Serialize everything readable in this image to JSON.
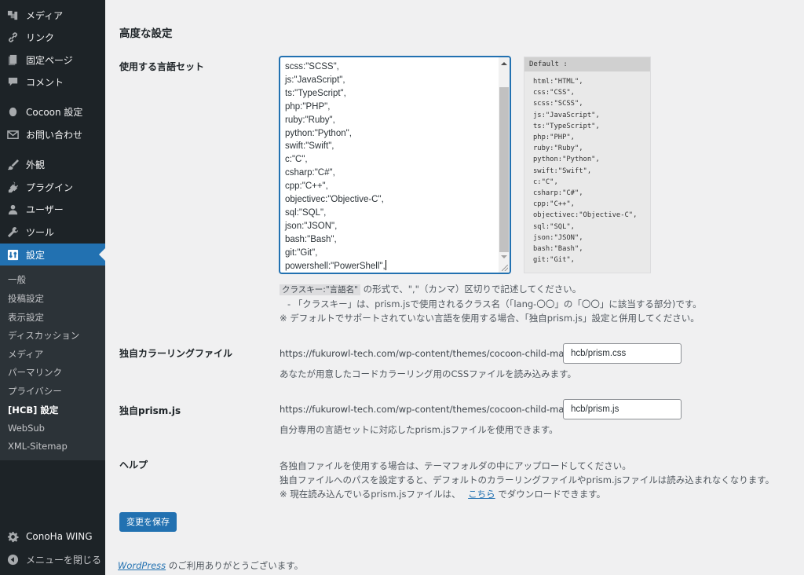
{
  "sidebar": {
    "menu": [
      {
        "label": "メディア",
        "icon": "media-icon"
      },
      {
        "label": "リンク",
        "icon": "link-icon"
      },
      {
        "label": "固定ページ",
        "icon": "page-icon"
      },
      {
        "label": "コメント",
        "icon": "comment-icon"
      },
      {
        "label": "Cocoon 設定",
        "icon": "cocoon-icon"
      },
      {
        "label": "お問い合わせ",
        "icon": "mail-icon"
      },
      {
        "label": "外観",
        "icon": "appearance-icon"
      },
      {
        "label": "プラグイン",
        "icon": "plugin-icon"
      },
      {
        "label": "ユーザー",
        "icon": "user-icon"
      },
      {
        "label": "ツール",
        "icon": "tool-icon"
      },
      {
        "label": "設定",
        "icon": "settings-icon"
      }
    ],
    "submenu": [
      "一般",
      "投稿設定",
      "表示設定",
      "ディスカッション",
      "メディア",
      "パーマリンク",
      "プライバシー",
      "[HCB] 設定",
      "WebSub",
      "XML-Sitemap"
    ],
    "submenu_active": "[HCB] 設定",
    "conoha": "ConoHa WING",
    "collapse": "メニューを閉じる"
  },
  "main": {
    "section_title": "高度な設定",
    "lang_set": {
      "label": "使用する言語セット",
      "textarea_lines": [
        "scss:\"SCSS\",",
        "js:\"JavaScript\",",
        "ts:\"TypeScript\",",
        "php:\"PHP\",",
        "ruby:\"Ruby\",",
        "python:\"Python\",",
        "swift:\"Swift\",",
        "c:\"C\",",
        "csharp:\"C#\",",
        "cpp:\"C++\",",
        "objectivec:\"Objective-C\",",
        "sql:\"SQL\",",
        "json:\"JSON\",",
        "bash:\"Bash\",",
        "git:\"Git\",",
        "powershell:\"PowerShell\","
      ],
      "default_header": "Default :",
      "default_lines": [
        "html:\"HTML\",",
        "css:\"CSS\",",
        "scss:\"SCSS\",",
        "js:\"JavaScript\",",
        "ts:\"TypeScript\",",
        "php:\"PHP\",",
        "ruby:\"Ruby\",",
        "python:\"Python\",",
        "swift:\"Swift\",",
        "c:\"C\",",
        "csharp:\"C#\",",
        "cpp:\"C++\",",
        "objectivec:\"Objective-C\",",
        "sql:\"SQL\",",
        "json:\"JSON\",",
        "bash:\"Bash\",",
        "git:\"Git\","
      ],
      "note_chip": "クラスキー:\"言語名\"",
      "note1": " の形式で、\",\"（カンマ）区切りで記述してください。",
      "note2": "- 「クラスキー」は、prism.jsで使用されるクラス名（「lang-〇〇」の「〇〇」に該当する部分)です。",
      "note3": "※ デフォルトでサポートされていない言語を使用する場合、「独自prism.js」設定と併用してください。"
    },
    "coloring": {
      "label": "独自カラーリングファイル",
      "prefix": "https://fukurowl-tech.com/wp-content/themes/cocoon-child-master/",
      "value": "hcb/prism.css",
      "desc": "あなたが用意したコードカラーリング用のCSSファイルを読み込みます。"
    },
    "prism": {
      "label": "独自prism.js",
      "prefix": "https://fukurowl-tech.com/wp-content/themes/cocoon-child-master/",
      "value": "hcb/prism.js",
      "desc": "自分専用の言語セットに対応したprism.jsファイルを使用できます。"
    },
    "help": {
      "label": "ヘルプ",
      "line1": "各独自ファイルを使用する場合は、テーマフォルダの中にアップロードしてください。",
      "line2": "独自ファイルへのパスを設定すると、デフォルトのカラーリングファイルやprism.jsファイルは読み込まれなくなります。",
      "line3_pre": "※ 現在読み込んでいるprism.jsファイルは、",
      "line3_link": "こちら",
      "line3_post": " でダウンロードできます。"
    },
    "save_button": "変更を保存",
    "footer_link": "WordPress",
    "footer_text": " のご利用ありがとうございます。"
  }
}
